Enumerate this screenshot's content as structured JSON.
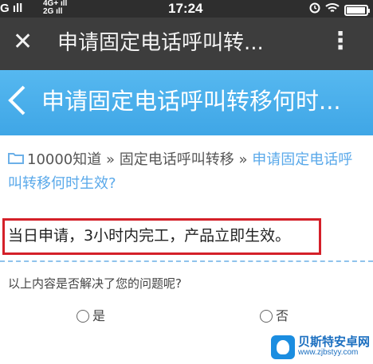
{
  "status_bar": {
    "signal_left": "G ıll",
    "network_top": "4G+ ıll",
    "network_bottom": "2G ıll",
    "time": "17:24",
    "battery_level": 0.9
  },
  "title_bar": {
    "close_icon": "close-icon",
    "title": "申请固定电话呼叫转...",
    "more_icon": "more-vertical-icon"
  },
  "header": {
    "back_icon": "chevron-left-icon",
    "title": "申请固定电话呼叫转移何时..."
  },
  "breadcrumb": {
    "folder_icon": "folder-icon",
    "items": [
      "10000知道",
      "固定电话呼叫转移"
    ],
    "separator": "»",
    "current": "申请固定电话呼叫转移何时生效?"
  },
  "answer": {
    "text": "当日申请，3小时内完工，产品立即生效。"
  },
  "feedback": {
    "question": "以上内容是否解决了您的问题呢?",
    "yes_label": "是",
    "no_label": "否"
  },
  "watermark": {
    "name": "贝斯特安卓网",
    "url": "www.zjbstyy.com"
  },
  "colors": {
    "status_bar_bg": "#2e2e2e",
    "title_bar_bg": "#3d3d3d",
    "header_bg": "#47aeea",
    "link": "#5aa9ea",
    "highlight_border": "#d42029"
  }
}
